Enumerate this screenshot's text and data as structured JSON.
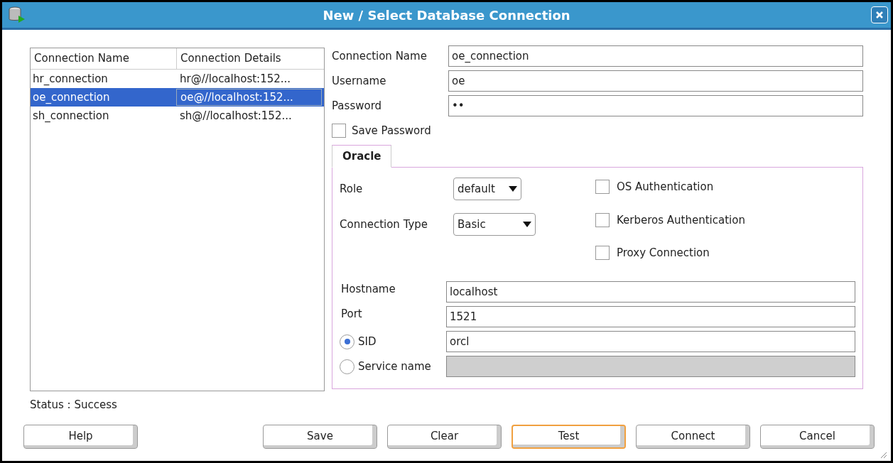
{
  "window": {
    "title": "New / Select Database Connection"
  },
  "connections": {
    "columns": [
      "Connection Name",
      "Connection Details"
    ],
    "rows": [
      {
        "name": "hr_connection",
        "details": "hr@//localhost:152...",
        "selected": false
      },
      {
        "name": "oe_connection",
        "details": "oe@//localhost:152...",
        "selected": true
      },
      {
        "name": "sh_connection",
        "details": "sh@//localhost:152...",
        "selected": false
      }
    ]
  },
  "fields": [
    {
      "label": "Connection Name",
      "value": "oe_connection"
    },
    {
      "label": "Username",
      "value": "oe"
    },
    {
      "label": "Password",
      "value": "••"
    }
  ],
  "save_password": {
    "label": "Save Password",
    "checked": false
  },
  "tabs": [
    {
      "label": "Oracle",
      "selected": true
    }
  ],
  "oracle": {
    "role": {
      "label": "Role",
      "value": "default"
    },
    "connection_type": {
      "label": "Connection Type",
      "value": "Basic"
    },
    "options": [
      {
        "label": "OS Authentication",
        "checked": false
      },
      {
        "label": "Kerberos Authentication",
        "checked": false
      },
      {
        "label": "Proxy Connection",
        "checked": false
      }
    ],
    "hostname": {
      "label": "Hostname",
      "value": "localhost"
    },
    "port": {
      "label": "Port",
      "value": "1521"
    },
    "targets": [
      {
        "label": "SID",
        "value": "orcl",
        "selected": true,
        "disabled": false
      },
      {
        "label": "Service name",
        "selected": false,
        "disabled": true
      }
    ]
  },
  "status": "Status : Success",
  "buttons": [
    {
      "label": "Help",
      "focused": false
    },
    {
      "label": "Save",
      "focused": false
    },
    {
      "label": "Clear",
      "focused": false
    },
    {
      "label": "Test",
      "focused": true
    },
    {
      "label": "Connect",
      "focused": false
    },
    {
      "label": "Cancel",
      "focused": false
    }
  ]
}
